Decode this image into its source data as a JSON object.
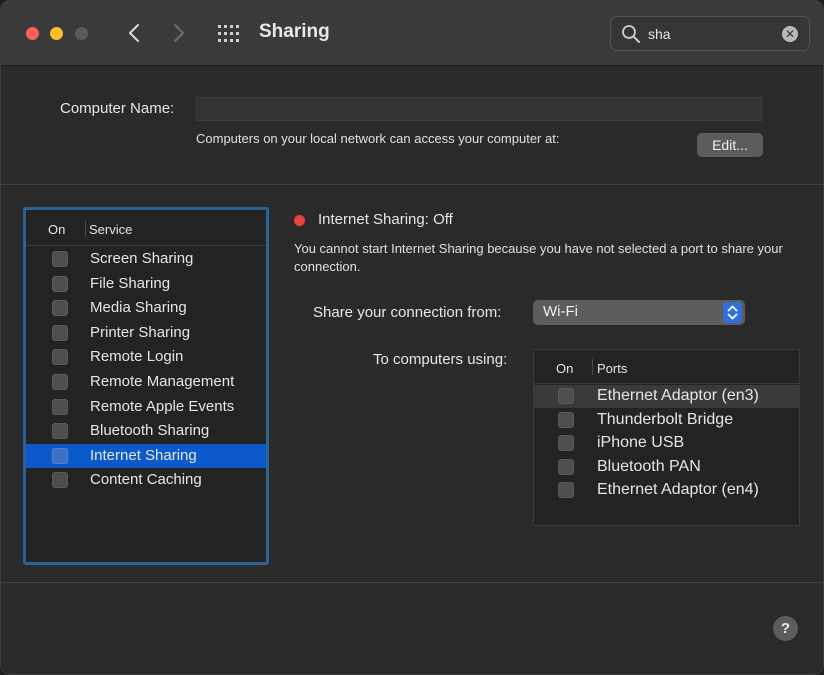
{
  "window": {
    "title": "Sharing",
    "search": {
      "value": "sha",
      "clear_glyph": "✕"
    }
  },
  "computer_name": {
    "label": "Computer Name:",
    "value": "",
    "info": "Computers on your local network can access your computer at:",
    "edit_label": "Edit..."
  },
  "services": {
    "header_on": "On",
    "header_service": "Service",
    "items": [
      {
        "label": "Screen Sharing",
        "checked": false
      },
      {
        "label": "File Sharing",
        "checked": false
      },
      {
        "label": "Media Sharing",
        "checked": false
      },
      {
        "label": "Printer Sharing",
        "checked": false
      },
      {
        "label": "Remote Login",
        "checked": false
      },
      {
        "label": "Remote Management",
        "checked": false
      },
      {
        "label": "Remote Apple Events",
        "checked": false
      },
      {
        "label": "Bluetooth Sharing",
        "checked": false
      },
      {
        "label": "Internet Sharing",
        "checked": false,
        "selected": true
      },
      {
        "label": "Content Caching",
        "checked": false
      }
    ]
  },
  "detail": {
    "status": "Internet Sharing: Off",
    "status_color": "#e8433f",
    "description": "You cannot start Internet Sharing because you have not selected a port to share your connection.",
    "share_from_label": "Share your connection from:",
    "share_from_value": "Wi-Fi",
    "to_label": "To computers using:",
    "ports_header_on": "On",
    "ports_header_ports": "Ports",
    "ports": [
      {
        "label": "Ethernet Adaptor (en3)",
        "checked": false,
        "highlighted": true
      },
      {
        "label": "Thunderbolt Bridge",
        "checked": false
      },
      {
        "label": "iPhone USB",
        "checked": false
      },
      {
        "label": "Bluetooth PAN",
        "checked": false
      },
      {
        "label": "Ethernet Adaptor (en4)",
        "checked": false
      }
    ]
  },
  "help_label": "?",
  "colors": {
    "selection": "#0c59c9",
    "focus_ring": "#2a6496",
    "stepper": "#2e6fdb"
  }
}
